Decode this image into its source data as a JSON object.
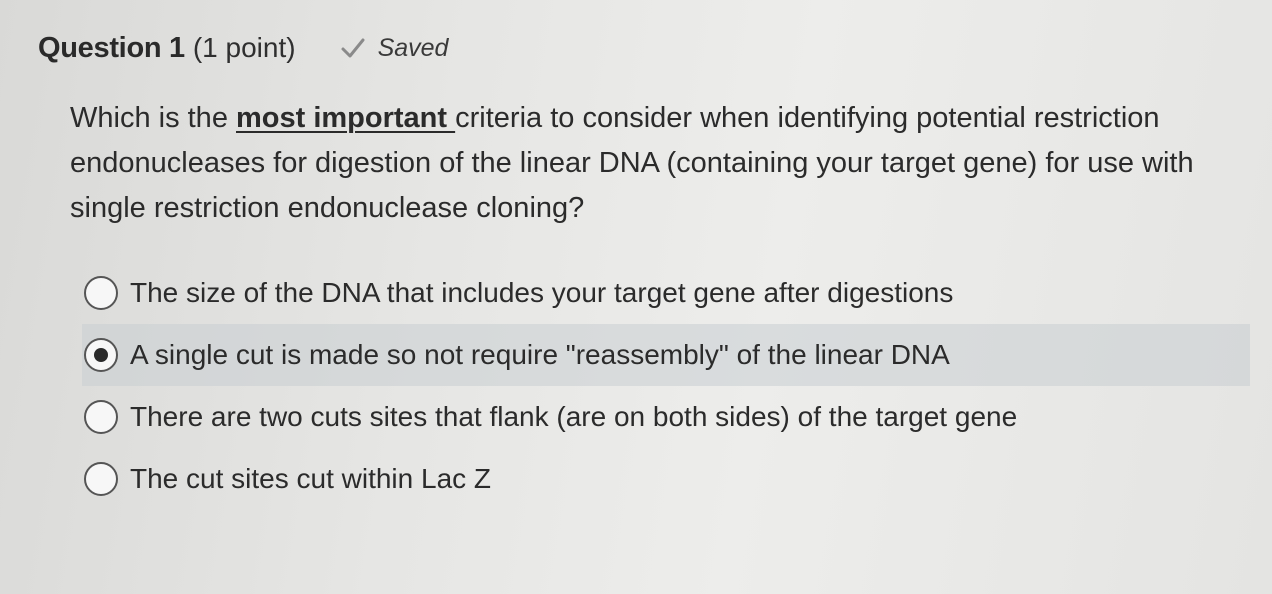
{
  "question": {
    "number_label": "Question 1",
    "points_label": "(1 point)",
    "saved_label": "Saved",
    "text_before": "Which is the ",
    "text_emphasis": "most important ",
    "text_after": "criteria to consider when identifying potential restriction endonucleases for digestion of the linear DNA (containing your target gene) for use with single restriction endonuclease cloning?"
  },
  "options": [
    {
      "label": "The size of the DNA that includes your target gene after digestions",
      "selected": false
    },
    {
      "label": "A single cut is made so not require \"reassembly\" of the linear DNA",
      "selected": true
    },
    {
      "label": "There are two cuts sites that flank (are on both sides) of the target gene",
      "selected": false
    },
    {
      "label": "The cut sites cut within Lac Z",
      "selected": false
    }
  ],
  "icons": {
    "saved": "check-icon"
  },
  "colors": {
    "selected_row": "#c8cdd2",
    "text": "#2b2b2b",
    "check": "#8a8a8a"
  }
}
